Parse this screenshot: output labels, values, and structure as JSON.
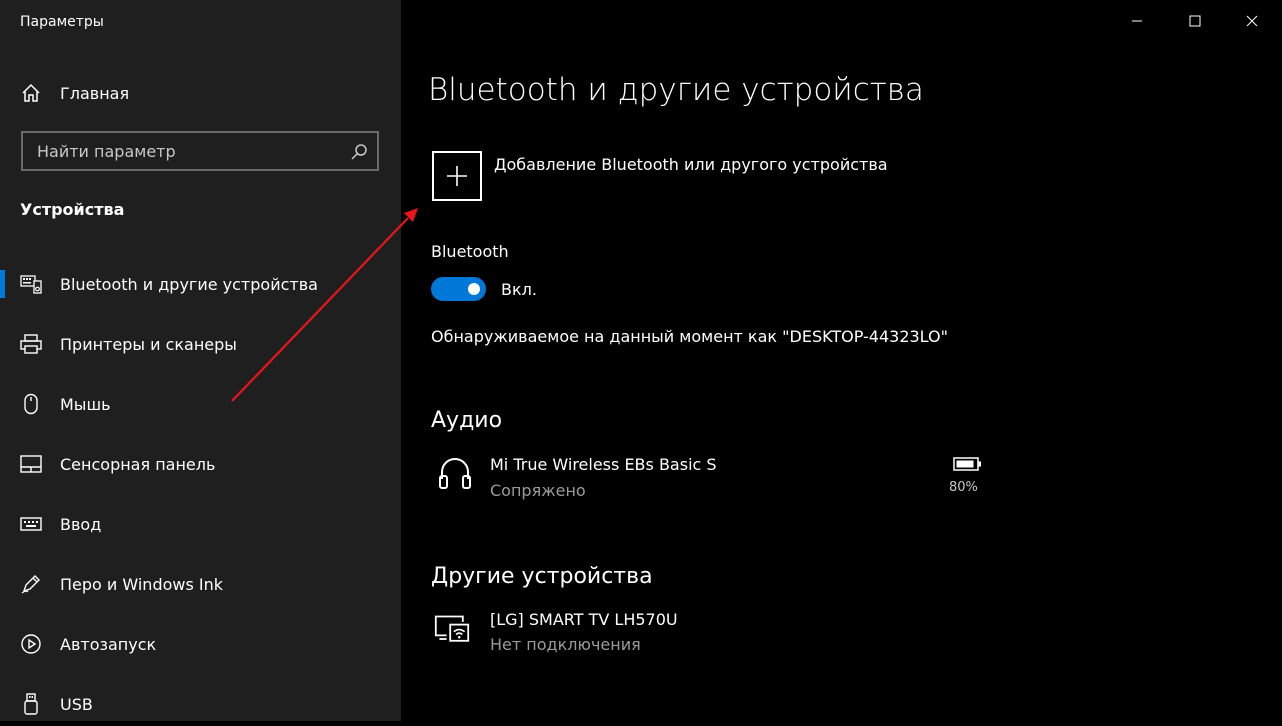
{
  "window": {
    "title": "Параметры",
    "controls": {
      "minimize": "minimize-icon",
      "maximize": "maximize-icon",
      "close": "close-icon"
    }
  },
  "sidebar": {
    "home_label": "Главная",
    "search_placeholder": "Найти параметр",
    "section_title": "Устройства",
    "items": [
      {
        "label": "Bluetooth и другие устройства",
        "icon": "bluetooth-devices-icon",
        "active": true
      },
      {
        "label": "Принтеры и сканеры",
        "icon": "printer-icon"
      },
      {
        "label": "Мышь",
        "icon": "mouse-icon"
      },
      {
        "label": "Сенсорная панель",
        "icon": "touchpad-icon"
      },
      {
        "label": "Ввод",
        "icon": "keyboard-icon"
      },
      {
        "label": "Перо и Windows Ink",
        "icon": "pen-icon"
      },
      {
        "label": "Автозапуск",
        "icon": "autoplay-icon"
      },
      {
        "label": "USB",
        "icon": "usb-icon"
      }
    ]
  },
  "main": {
    "title": "Bluetooth и другие устройства",
    "add_device_label": "Добавление Bluetooth или другого устройства",
    "bluetooth": {
      "heading": "Bluetooth",
      "toggle_state": "Вкл.",
      "discoverable_text": "Обнаруживаемое на данный момент как \"DESKTOP-44323LO\""
    },
    "audio": {
      "heading": "Аудио",
      "devices": [
        {
          "name": "Mi True Wireless EBs Basic S",
          "status": "Сопряжено",
          "battery": "80%",
          "icon": "headphones-icon"
        }
      ]
    },
    "other": {
      "heading": "Другие устройства",
      "devices": [
        {
          "name": "[LG] SMART TV LH570U",
          "status": "Нет подключения",
          "icon": "wireless-display-icon"
        }
      ]
    }
  },
  "colors": {
    "accent": "#0078d7",
    "sidebar_bg": "#1f1f1f",
    "main_bg": "#000000",
    "arrow": "#e8151b"
  }
}
